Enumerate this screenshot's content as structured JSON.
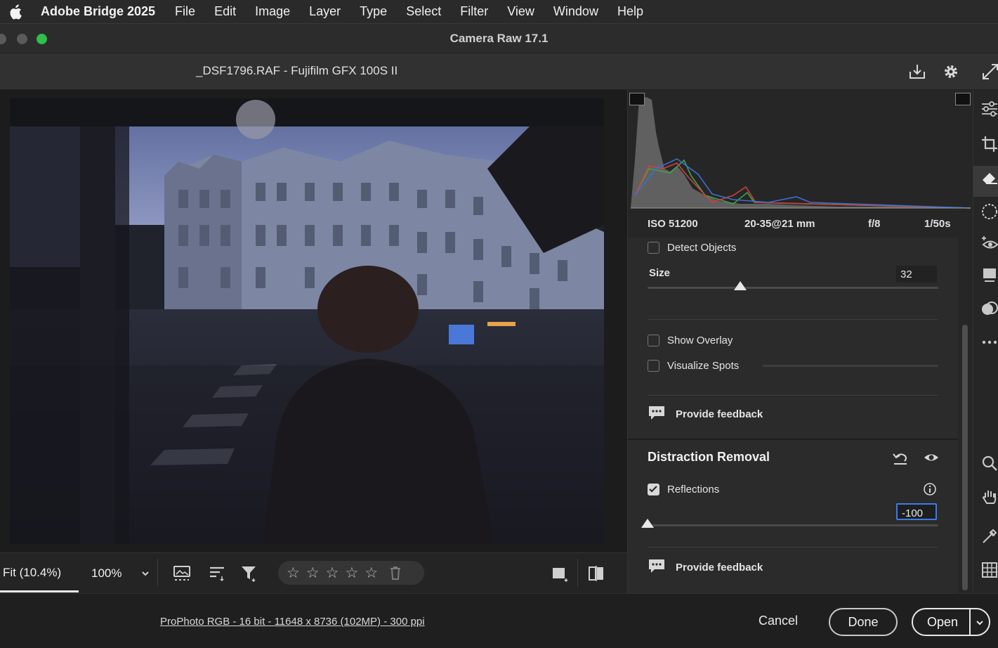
{
  "menubar": {
    "app_name": "Adobe Bridge 2025",
    "items": [
      "File",
      "Edit",
      "Image",
      "Layer",
      "Type",
      "Select",
      "Filter",
      "View",
      "Window",
      "Help"
    ]
  },
  "window": {
    "title": "Camera Raw 17.1"
  },
  "file_header": {
    "filename": "_DSF1796.RAF  -  Fujifilm GFX 100S II"
  },
  "exif": {
    "iso": "ISO 51200",
    "lens": "20-35@21 mm",
    "aperture": "f/8",
    "shutter": "1/50s"
  },
  "spot_section": {
    "detect_objects_label": "Detect Objects",
    "detect_objects_checked": false,
    "size_label": "Size",
    "size_value": "32",
    "size_fraction": 0.32,
    "show_overlay_label": "Show Overlay",
    "show_overlay_checked": false,
    "visualize_spots_label": "Visualize Spots",
    "visualize_spots_checked": false,
    "feedback_label": "Provide feedback"
  },
  "distraction_section": {
    "title": "Distraction Removal",
    "reflections_label": "Reflections",
    "reflections_checked": true,
    "reflections_value": "-100",
    "reflections_fraction": 0.0,
    "feedback_label": "Provide feedback"
  },
  "bottom_toolbar": {
    "fit_label": "Fit (10.4%)",
    "zoom_label": "100%",
    "star_glyph": "☆"
  },
  "footer": {
    "workflow_text": "ProPhoto RGB - 16 bit - 11648 x 8736 (102MP) - 300 ppi",
    "cancel_label": "Cancel",
    "done_label": "Done",
    "open_label": "Open"
  },
  "colors": {
    "accent_blue": "#3b7bea",
    "panel_bg": "#2b2b2b",
    "traffic_green": "#2fbf4a"
  }
}
